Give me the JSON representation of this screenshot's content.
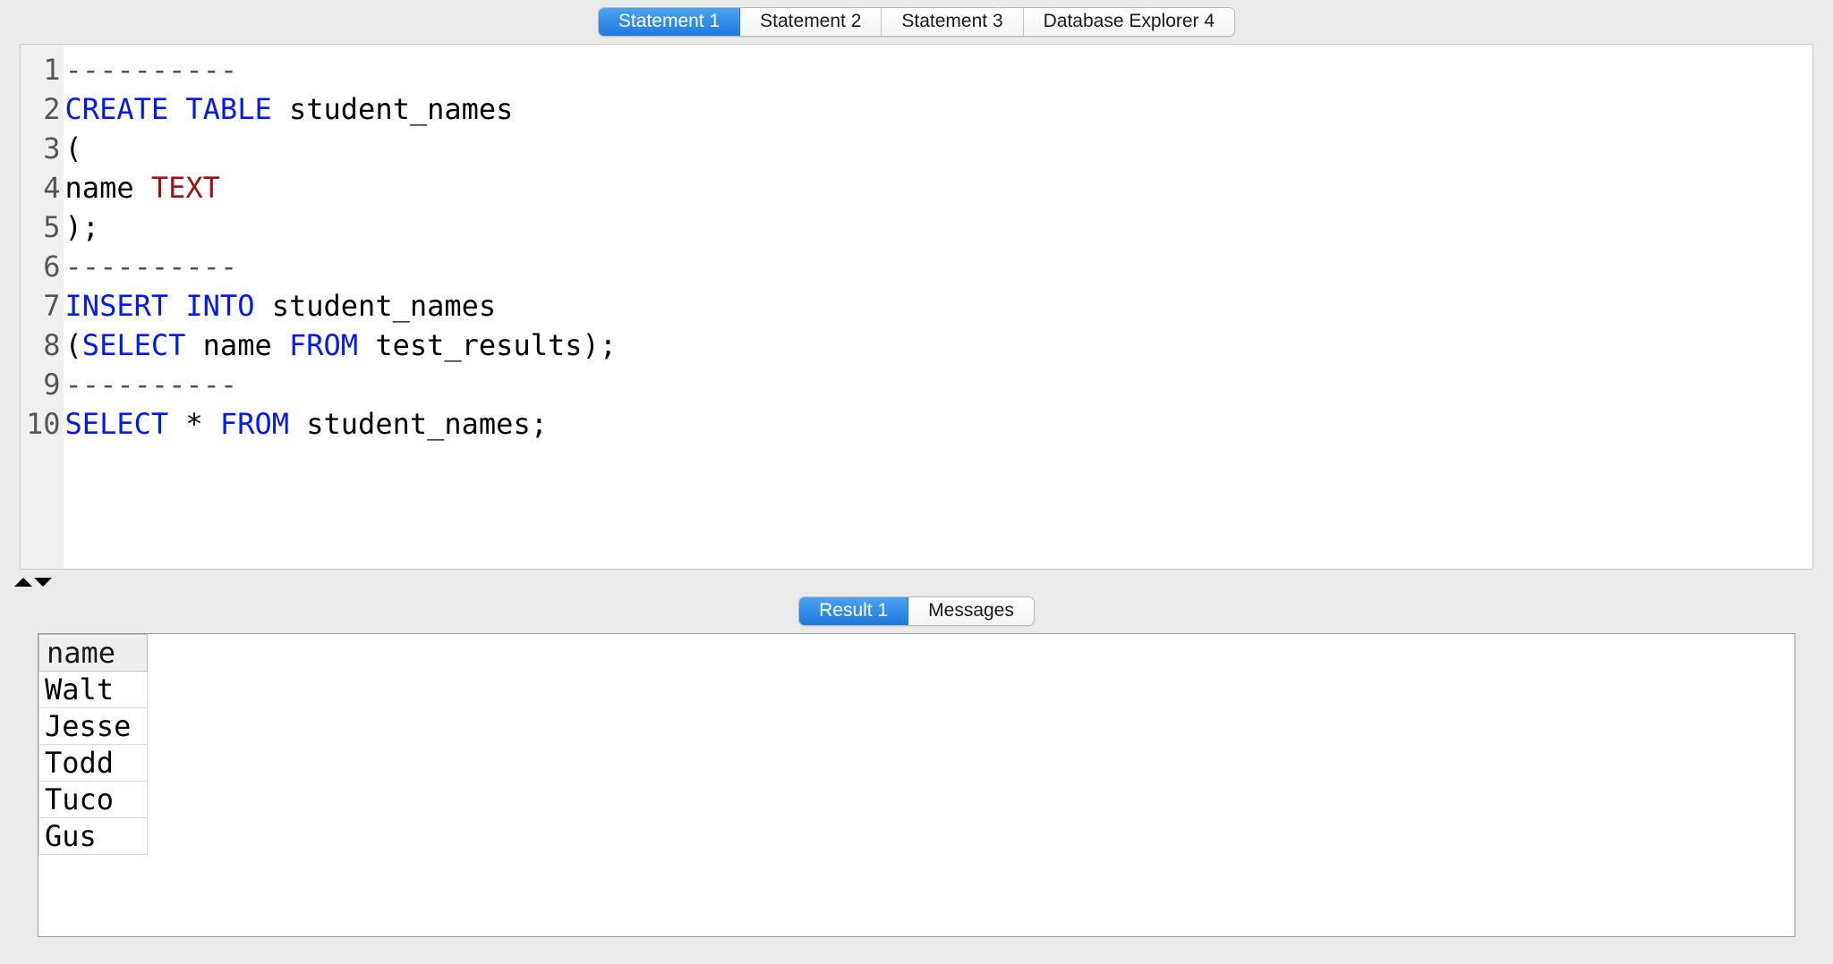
{
  "top_tabs": {
    "active_index": 0,
    "items": [
      {
        "label": "Statement 1"
      },
      {
        "label": "Statement 2"
      },
      {
        "label": "Statement 3"
      },
      {
        "label": "Database Explorer 4"
      }
    ]
  },
  "editor": {
    "line_numbers": [
      "1",
      "2",
      "3",
      "4",
      "5",
      "6",
      "7",
      "8",
      "9",
      "10"
    ],
    "lines": [
      {
        "tokens": [
          {
            "t": "----------",
            "cls": "cmt"
          }
        ]
      },
      {
        "tokens": [
          {
            "t": "CREATE TABLE",
            "cls": "kw"
          },
          {
            "t": " student_names",
            "cls": ""
          }
        ]
      },
      {
        "tokens": [
          {
            "t": "(",
            "cls": ""
          }
        ]
      },
      {
        "tokens": [
          {
            "t": "name ",
            "cls": ""
          },
          {
            "t": "TEXT",
            "cls": "typ"
          }
        ]
      },
      {
        "tokens": [
          {
            "t": ");",
            "cls": ""
          }
        ]
      },
      {
        "tokens": [
          {
            "t": "----------",
            "cls": "cmt"
          }
        ]
      },
      {
        "tokens": [
          {
            "t": "INSERT INTO",
            "cls": "kw"
          },
          {
            "t": " student_names",
            "cls": ""
          }
        ]
      },
      {
        "tokens": [
          {
            "t": "(",
            "cls": ""
          },
          {
            "t": "SELECT",
            "cls": "kw"
          },
          {
            "t": " name ",
            "cls": ""
          },
          {
            "t": "FROM",
            "cls": "kw"
          },
          {
            "t": " test_results);",
            "cls": ""
          }
        ]
      },
      {
        "tokens": [
          {
            "t": "----------",
            "cls": "cmt"
          }
        ]
      },
      {
        "tokens": [
          {
            "t": "SELECT",
            "cls": "kw"
          },
          {
            "t": " * ",
            "cls": ""
          },
          {
            "t": "FROM",
            "cls": "kw"
          },
          {
            "t": " student_names;",
            "cls": ""
          }
        ]
      }
    ]
  },
  "bottom_tabs": {
    "active_index": 0,
    "items": [
      {
        "label": "Result 1"
      },
      {
        "label": "Messages"
      }
    ]
  },
  "results": {
    "columns": [
      "name"
    ],
    "rows": [
      [
        "Walt"
      ],
      [
        "Jesse"
      ],
      [
        "Todd"
      ],
      [
        "Tuco"
      ],
      [
        "Gus"
      ]
    ]
  }
}
